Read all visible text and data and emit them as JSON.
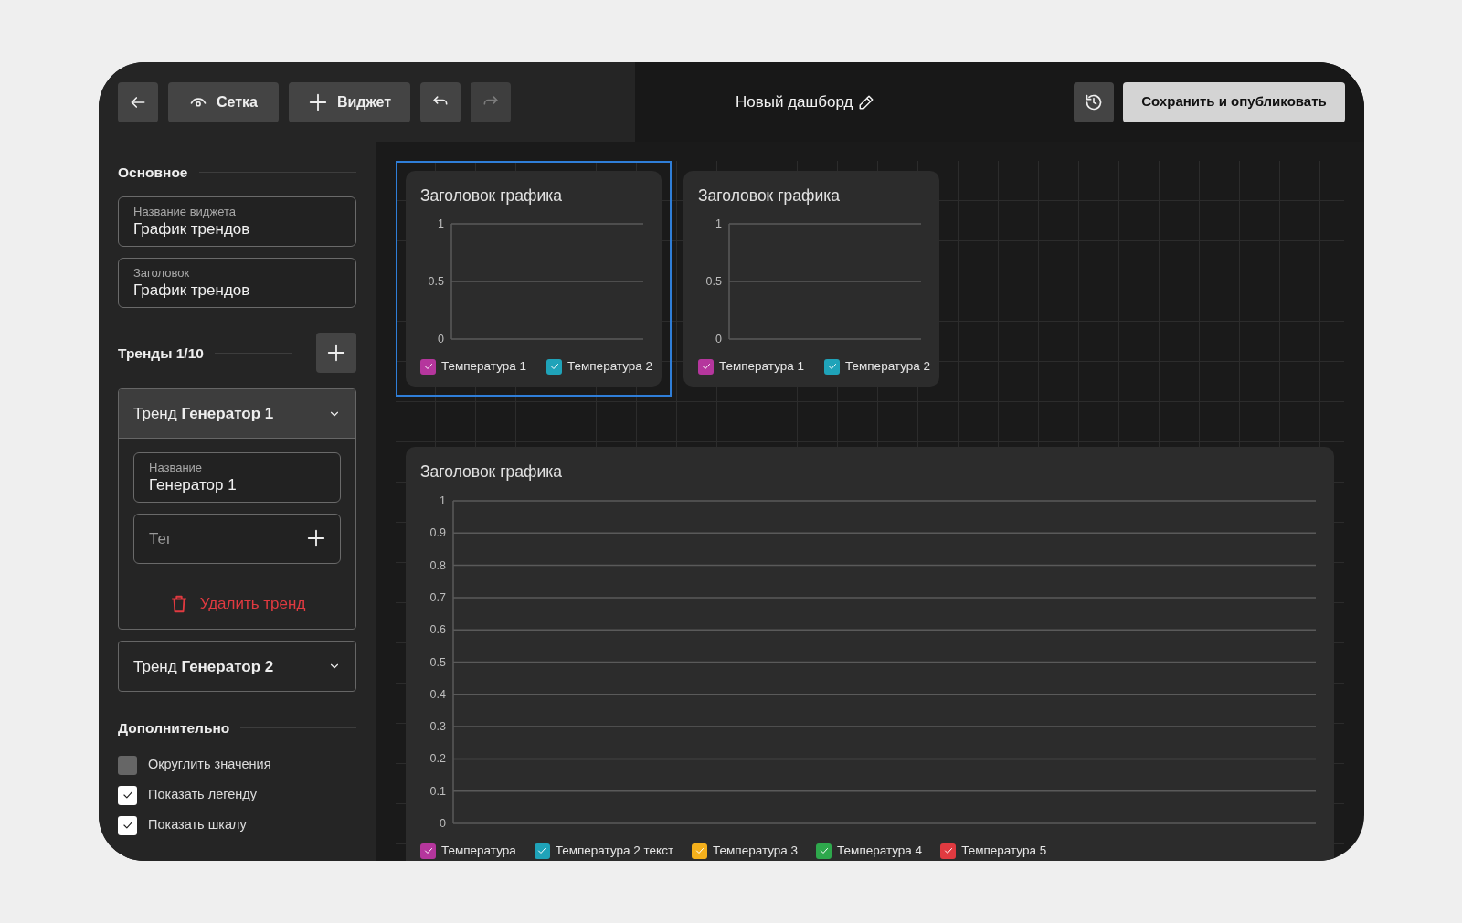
{
  "toolbar": {
    "buttons": [
      {
        "kind": "back",
        "disabled": false
      },
      {
        "kind": "view",
        "label": "Сетка",
        "disabled": false
      },
      {
        "kind": "add",
        "label": "Виджет",
        "disabled": false
      },
      {
        "kind": "undo",
        "disabled": false
      },
      {
        "kind": "redo",
        "disabled": true
      }
    ]
  },
  "dashboard_title": "Новый дашборд",
  "actions": {
    "publish": "Сохранить и опубликовать"
  },
  "sidebar": {
    "main": {
      "heading": "Основное",
      "fields": [
        {
          "label": "Название виджета",
          "value": "График трендов"
        },
        {
          "label": "Заголовок",
          "value": "График трендов"
        }
      ]
    },
    "trends": {
      "heading": "Тренды 1/10",
      "items": [
        {
          "title": "Тренд **Генератор 1**",
          "expanded": true,
          "name_label": "Название",
          "name_value": "Генератор 1",
          "tag_placeholder": "Тег",
          "delete_label": "Удалить тренд"
        },
        {
          "title": "Тренд **Генератор 2**",
          "expanded": false
        }
      ]
    },
    "extra": {
      "heading": "Дополнительно",
      "options": [
        {
          "label": "Округлить значения",
          "checked": false
        },
        {
          "label": "Показать легенду",
          "checked": true
        },
        {
          "label": "Показать шкалу",
          "checked": true
        }
      ]
    }
  },
  "widgets": [
    {
      "kind": "small",
      "selected": true,
      "chart_data": {
        "type": "line",
        "title": "Заголовок графика",
        "categories": [
          null,
          null
        ],
        "ylim": [
          0,
          1
        ],
        "yticks": [
          0,
          0.5,
          1
        ],
        "grid": true,
        "series": [
          {
            "name": "Температура 1",
            "color": "#b5369d",
            "values": [
              null,
              null
            ]
          },
          {
            "name": "Температура 2",
            "color": "#1fa3b9",
            "values": [
              null,
              null
            ]
          }
        ]
      },
      "legend": [
        {
          "checked": true
        },
        {
          "checked": true
        }
      ]
    },
    {
      "kind": "small",
      "selected": false,
      "chart_data": {
        "type": "line",
        "title": "Заголовок графика",
        "categories": [
          null,
          null
        ],
        "ylim": [
          0,
          1
        ],
        "yticks": [
          0,
          0.5,
          1
        ],
        "grid": true,
        "series": [
          {
            "name": "Температура 1",
            "color": "#b5369d",
            "values": [
              null,
              null
            ]
          },
          {
            "name": "Температура 2",
            "color": "#1fa3b9",
            "values": [
              null,
              null
            ]
          }
        ]
      },
      "legend": [
        {
          "checked": true
        },
        {
          "checked": true
        }
      ]
    },
    {
      "kind": "wide",
      "selected": false,
      "chart_data": {
        "type": "line",
        "title": "Заголовок графика",
        "categories": [
          null,
          null
        ],
        "ylim": [
          0,
          1
        ],
        "yticks": [
          0,
          0.1,
          0.2,
          0.3,
          0.4,
          0.5,
          0.6,
          0.7,
          0.8,
          0.9,
          1
        ],
        "grid": true,
        "series": [
          {
            "name": "Температура",
            "color": "#b5369d",
            "values": [
              null,
              null
            ]
          },
          {
            "name": "Температура 2 текст",
            "color": "#1fa3b9",
            "values": [
              null,
              null
            ]
          },
          {
            "name": "Температура 3",
            "color": "#f4b01c",
            "values": [
              null,
              null
            ]
          },
          {
            "name": "Температура 4",
            "color": "#2ea84c",
            "values": [
              null,
              null
            ]
          },
          {
            "name": "Температура 5",
            "color": "#e03a40",
            "values": [
              null,
              null
            ]
          }
        ]
      },
      "legend": [
        {
          "checked": true
        },
        {
          "checked": true
        },
        {
          "checked": true
        },
        {
          "checked": true
        },
        {
          "checked": true
        }
      ]
    }
  ]
}
